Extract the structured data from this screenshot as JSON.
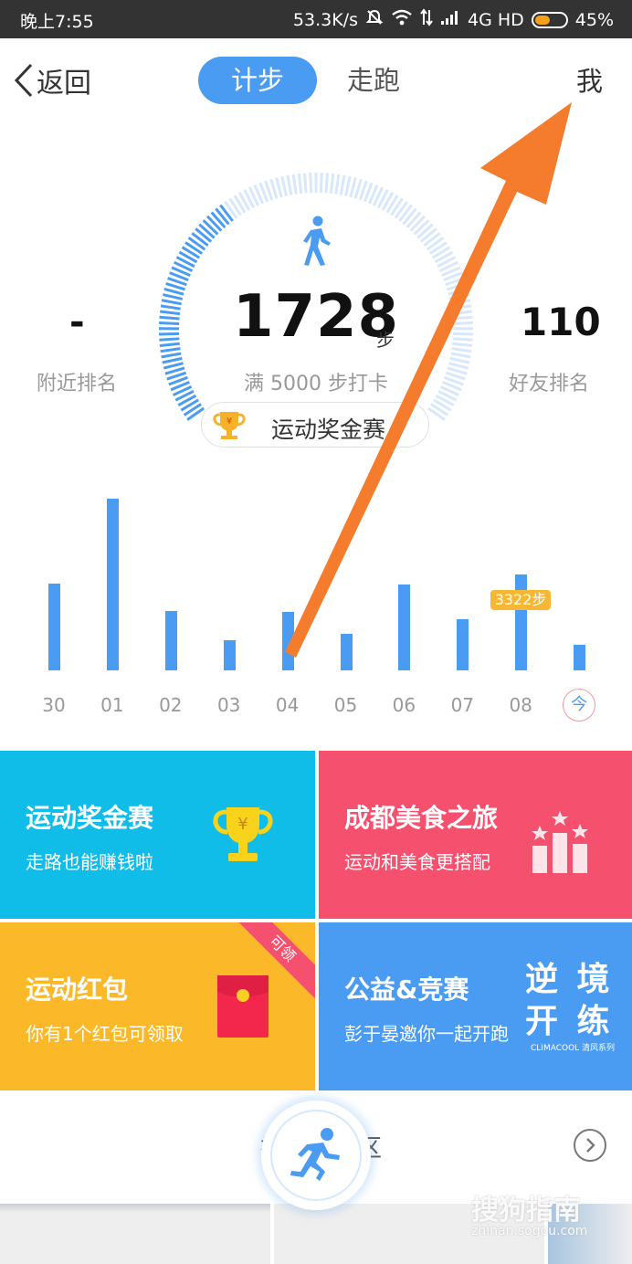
{
  "status_bar": {
    "time": "晚上7:55",
    "speed": "53.3K/s",
    "network": "4G HD",
    "battery": "45%"
  },
  "nav": {
    "back_label": "返回",
    "tabs": [
      {
        "label": "计步",
        "active": true
      },
      {
        "label": "走跑",
        "active": false
      }
    ],
    "me_label": "我"
  },
  "summary": {
    "steps": "1728",
    "steps_unit": "步",
    "goal_text": "满 5000 步打卡",
    "progress_fraction": 0.35,
    "nearby_rank_value": "-",
    "nearby_rank_label": "附近排名",
    "friend_rank_value": "110",
    "friend_rank_label": "好友排名",
    "race_button_label": "运动奖金赛"
  },
  "chart_data": {
    "type": "bar",
    "categories": [
      "30",
      "01",
      "02",
      "03",
      "04",
      "05",
      "06",
      "07",
      "08",
      "今"
    ],
    "values": [
      3000,
      5950,
      2050,
      1050,
      2030,
      1250,
      2980,
      1760,
      3322,
      900
    ],
    "highlight_label": "3322步",
    "highlight_index": 8,
    "ylim": [
      0,
      6000
    ],
    "color": "#4a9bf2"
  },
  "tiles": [
    {
      "title": "运动奖金赛",
      "subtitle": "走路也能赚钱啦",
      "color": "#0fbde8",
      "icon": "trophy-icon"
    },
    {
      "title": "成都美食之旅",
      "subtitle": "运动和美食更搭配",
      "color": "#f5506e",
      "icon": "podium-stars-icon"
    },
    {
      "title": "运动红包",
      "subtitle": "你有1个红包可领取",
      "color": "#fbb829",
      "icon": "red-envelope-icon",
      "badge": "可领"
    },
    {
      "title": "公益&竞赛",
      "subtitle": "彭于晏邀你一起开跑",
      "color": "#4a9bf2",
      "slogan_line1": "逆 境",
      "slogan_line2": "开 练",
      "slogan_small": "CLIMACOOL 清风系列"
    }
  ],
  "bottom": {
    "label_left": "社",
    "label_right": "区"
  },
  "watermark": {
    "text": "搜狗指南",
    "url": "zhinan.sogou.com"
  },
  "colors": {
    "accent": "#4a9bf2",
    "arrow": "#f47c2c"
  }
}
